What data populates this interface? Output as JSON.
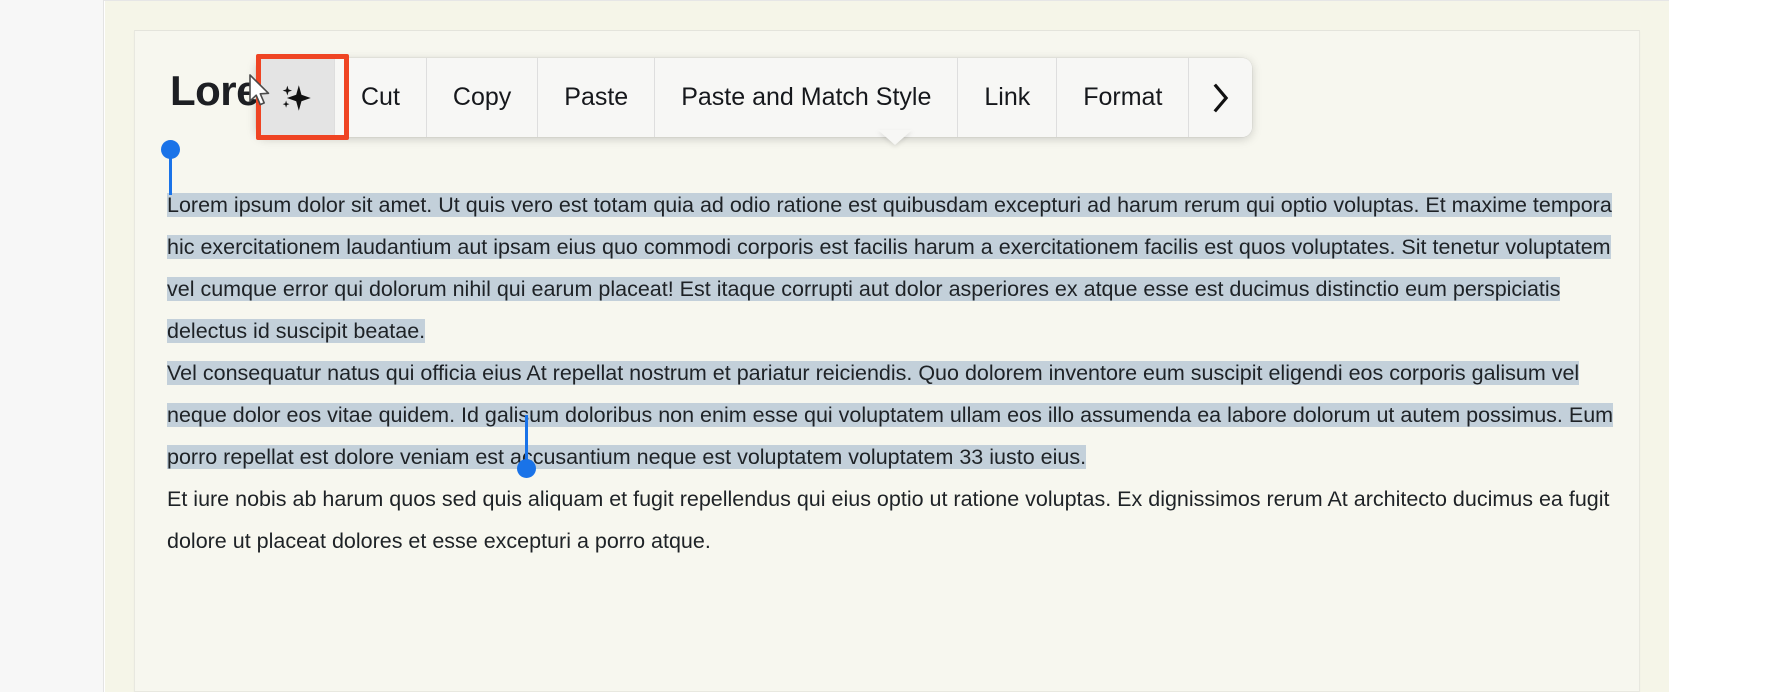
{
  "document": {
    "title": "Lorem",
    "paragraphs": [
      {
        "id": "p1",
        "selected": true,
        "text": "Lorem ipsum dolor sit amet. Ut quis vero est totam quia ad odio ratione est quibusdam excepturi ad harum rerum qui optio voluptas. Et maxime tempora hic exercitationem laudantium aut ipsam eius quo commodi corporis est facilis harum a exercitationem facilis est quos voluptates. Sit tenetur voluptatem vel cumque error qui dolorum nihil qui earum placeat! Est itaque corrupti aut dolor asperiores ex atque esse est ducimus distinctio eum perspiciatis delectus id suscipit beatae."
      },
      {
        "id": "p2",
        "selected": true,
        "text": "Vel consequatur natus qui officia eius At repellat nostrum et pariatur reiciendis. Quo dolorem inventore eum suscipit eligendi eos corporis galisum vel neque dolor eos vitae quidem. Id galisum doloribus non enim esse qui voluptatem ullam eos illo assumenda ea labore dolorum ut autem possimus. Eum porro repellat est dolore veniam est accusantium neque est voluptatem voluptatem 33 iusto eius."
      },
      {
        "id": "p3",
        "selected": false,
        "text": "Et iure nobis ab harum quos sed quis aliquam et fugit repellendus qui eius optio ut ratione voluptas. Ex dignissimos rerum At architecto ducimus ea fugit dolore ut placeat dolores et esse excepturi a porro atque."
      }
    ]
  },
  "context_menu": {
    "items": [
      {
        "id": "ai",
        "label": "",
        "icon": "sparkle-icon",
        "kind": "icon",
        "highlighted": true
      },
      {
        "id": "cut",
        "label": "Cut",
        "icon": null,
        "kind": "text",
        "highlighted": false
      },
      {
        "id": "copy",
        "label": "Copy",
        "icon": null,
        "kind": "text",
        "highlighted": false
      },
      {
        "id": "paste",
        "label": "Paste",
        "icon": null,
        "kind": "text",
        "highlighted": false
      },
      {
        "id": "paste_match",
        "label": "Paste and Match Style",
        "icon": null,
        "kind": "text",
        "highlighted": false
      },
      {
        "id": "link",
        "label": "Link",
        "icon": null,
        "kind": "text",
        "highlighted": false
      },
      {
        "id": "format",
        "label": "Format",
        "icon": null,
        "kind": "text",
        "highlighted": false
      },
      {
        "id": "more",
        "label": "",
        "icon": "chevron-right-icon",
        "kind": "chevron",
        "highlighted": false
      }
    ]
  },
  "selection": {
    "handle_color": "#1a73e8",
    "highlight_color": "#c3d0da",
    "start_handle": "selection-start-handle",
    "end_handle": "selection-end-handle"
  },
  "colors": {
    "highlight_box": "#ef4423",
    "page_background": "#f5f5e8",
    "card_background": "#f7f7ef",
    "menu_background": "#f7f7f5",
    "menu_active_background": "#e4e4e4",
    "text": "#1e2226"
  }
}
